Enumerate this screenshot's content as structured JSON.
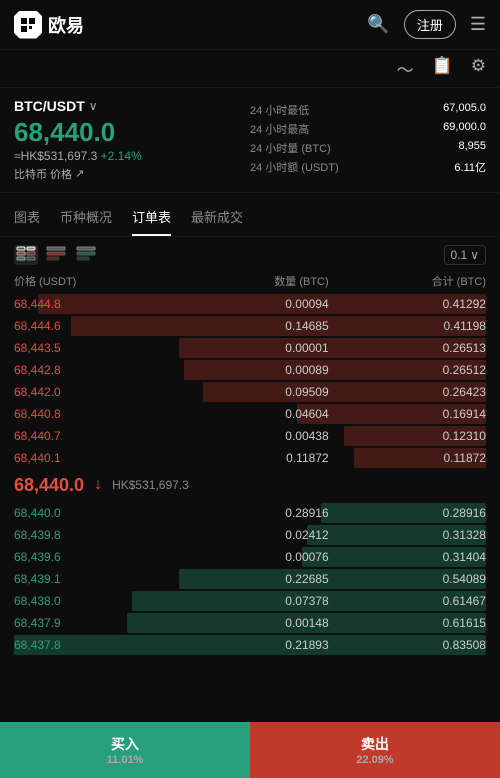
{
  "header": {
    "logo_text": "欧易",
    "register_label": "注册",
    "search_icon": "🔍",
    "menu_icon": "☰"
  },
  "sub_header": {
    "chart_icon": "📈",
    "news_icon": "📄",
    "settings_icon": "⚙"
  },
  "price_info": {
    "pair": "BTC/USDT",
    "big_price": "68,440.0",
    "hk_price": "≈HK$531,697.3",
    "change_pct": "+2.14%",
    "btc_link": "比特币 价格",
    "stats": [
      {
        "label": "24 小时最低",
        "value": "67,005.0"
      },
      {
        "label": "24 小时最高",
        "value": "69,000.0"
      },
      {
        "label": "24 小时量 (BTC)",
        "value": "8,955"
      },
      {
        "label": "24 小时额 (USDT)",
        "value": "6.11亿"
      }
    ]
  },
  "tabs": [
    {
      "label": "图表",
      "active": false
    },
    {
      "label": "币种概况",
      "active": false
    },
    {
      "label": "订单表",
      "active": true
    },
    {
      "label": "最新成交",
      "active": false
    }
  ],
  "orderbook": {
    "precision": "0.1",
    "col_headers": {
      "price": "价格 (USDT)",
      "qty": "数量 (BTC)",
      "total": "合计 (BTC)"
    },
    "asks": [
      {
        "price": "68,444.8",
        "qty": "0.00094",
        "total": "0.41292",
        "bar_pct": 95
      },
      {
        "price": "68,444.6",
        "qty": "0.14685",
        "total": "0.41198",
        "bar_pct": 88
      },
      {
        "price": "68,443.5",
        "qty": "0.00001",
        "total": "0.26513",
        "bar_pct": 65
      },
      {
        "price": "68,442.8",
        "qty": "0.00089",
        "total": "0.26512",
        "bar_pct": 64
      },
      {
        "price": "68,442.0",
        "qty": "0.09509",
        "total": "0.26423",
        "bar_pct": 60
      },
      {
        "price": "68,440.8",
        "qty": "0.04604",
        "total": "0.16914",
        "bar_pct": 40
      },
      {
        "price": "68,440.7",
        "qty": "0.00438",
        "total": "0.12310",
        "bar_pct": 30
      },
      {
        "price": "68,440.1",
        "qty": "0.11872",
        "total": "0.11872",
        "bar_pct": 28
      }
    ],
    "mid_price": "68,440.0",
    "mid_hk": "HK$531,697.3",
    "bids": [
      {
        "price": "68,440.0",
        "qty": "0.28916",
        "total": "0.28916",
        "bar_pct": 35
      },
      {
        "price": "68,439.8",
        "qty": "0.02412",
        "total": "0.31328",
        "bar_pct": 38
      },
      {
        "price": "68,439.6",
        "qty": "0.00076",
        "total": "0.31404",
        "bar_pct": 39
      },
      {
        "price": "68,439.1",
        "qty": "0.22685",
        "total": "0.54089",
        "bar_pct": 65
      },
      {
        "price": "68,438.0",
        "qty": "0.07378",
        "total": "0.61467",
        "bar_pct": 75
      },
      {
        "price": "68,437.9",
        "qty": "0.00148",
        "total": "0.61615",
        "bar_pct": 76
      },
      {
        "price": "68,437.8",
        "qty": "0.21893",
        "total": "0.83508",
        "bar_pct": 100
      }
    ]
  },
  "bottom": {
    "buy_label": "买入",
    "buy_sub": "11.01%",
    "sell_label": "卖出",
    "sell_sub": "22.09%"
  }
}
